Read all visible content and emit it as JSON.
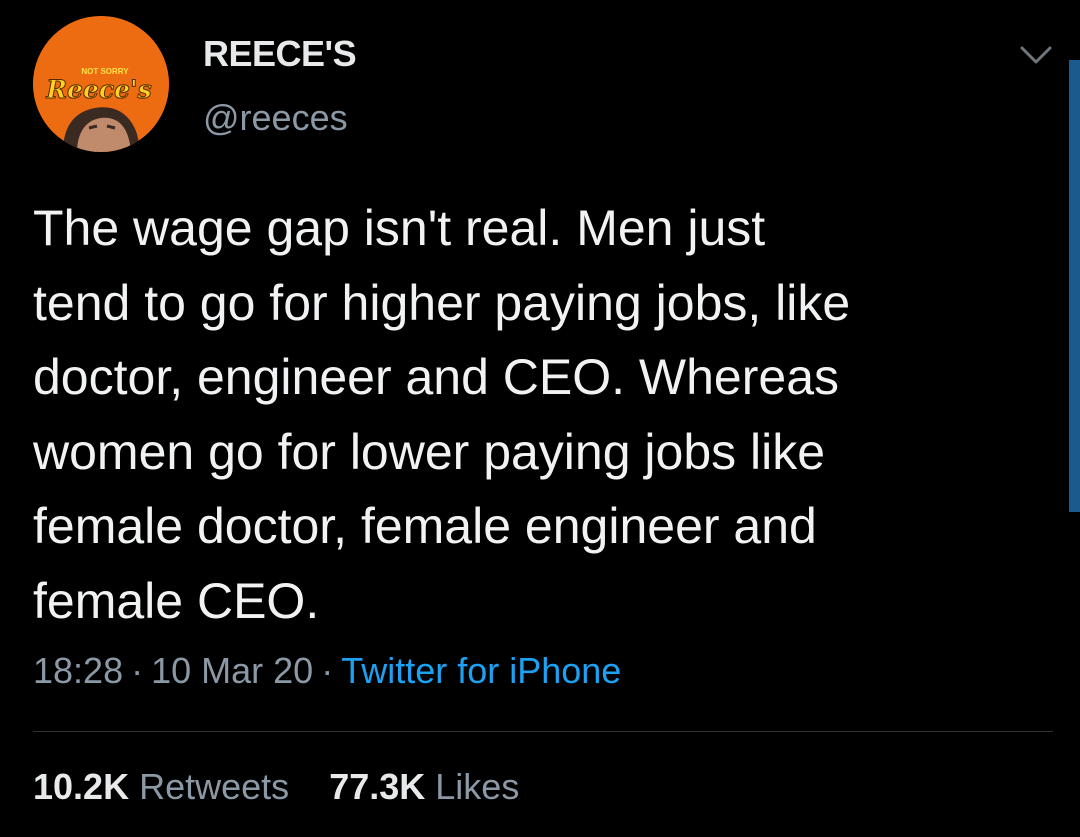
{
  "author": {
    "display_name": "REECE'S",
    "handle": "@reeces",
    "avatar": {
      "top_text": "NOT SORRY",
      "logo_text": "Reece's",
      "background_color": "#ee6c11"
    }
  },
  "tweet": {
    "lines": [
      "The wage gap isn't real. Men just",
      "tend to go for higher paying jobs, like",
      "doctor, engineer and CEO. Whereas",
      "women go for lower paying jobs like",
      "female doctor, female engineer and",
      "female CEO."
    ]
  },
  "meta": {
    "time": "18:28",
    "separator": "·",
    "date": "10 Mar 20",
    "source": "Twitter for iPhone"
  },
  "stats": {
    "retweets_count": "10.2K",
    "retweets_label": "Retweets",
    "likes_count": "77.3K",
    "likes_label": "Likes"
  },
  "colors": {
    "background": "#000000",
    "text": "#e7e9ea",
    "secondary_text": "#8b98a5",
    "link": "#1da1f2",
    "scrollbar": "#1b5a8c"
  },
  "icons": {
    "menu": "chevron-down-icon"
  }
}
